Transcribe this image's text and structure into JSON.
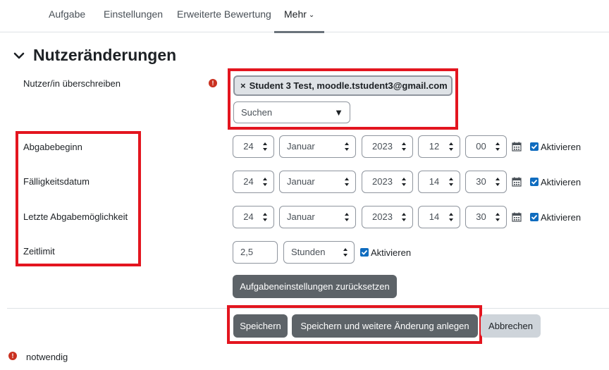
{
  "nav": {
    "tabs": [
      {
        "label": "Aufgabe"
      },
      {
        "label": "Einstellungen"
      },
      {
        "label": "Erweiterte Bewertung"
      },
      {
        "label": "Mehr"
      }
    ],
    "active_tab": "Mehr"
  },
  "section": {
    "title": "Nutzeränderungen"
  },
  "form": {
    "user_override": {
      "label": "Nutzer/in überschreiben",
      "selected_chip": "Student 3 Test, moodle.tstudent3@gmail.com",
      "chip_remove": "×",
      "search_placeholder": "Suchen"
    },
    "rows": [
      {
        "label": "Abgabebeginn",
        "day": "24",
        "month": "Januar",
        "year": "2023",
        "hour": "12",
        "minute": "00",
        "enable_label": "Aktivieren",
        "enabled": true
      },
      {
        "label": "Fälligkeitsdatum",
        "day": "24",
        "month": "Januar",
        "year": "2023",
        "hour": "14",
        "minute": "30",
        "enable_label": "Aktivieren",
        "enabled": true
      },
      {
        "label": "Letzte Abgabemöglichkeit",
        "day": "24",
        "month": "Januar",
        "year": "2023",
        "hour": "14",
        "minute": "30",
        "enable_label": "Aktivieren",
        "enabled": true
      }
    ],
    "time_limit": {
      "label": "Zeitlimit",
      "value": "2,5",
      "unit": "Stunden",
      "enable_label": "Aktivieren",
      "enabled": true
    },
    "reset_button": "Aufgabeneinstellungen zurücksetzen"
  },
  "actions": {
    "save": "Speichern",
    "save_and_add": "Speichern und weitere Änderung anlegen",
    "cancel": "Abbrechen"
  },
  "required_legend": "notwendig",
  "colors": {
    "highlight": "#e3151f",
    "primary_button": "#5d6368",
    "secondary_button": "#ced4da",
    "checkbox": "#0f6cbf",
    "required": "#ca3120"
  }
}
